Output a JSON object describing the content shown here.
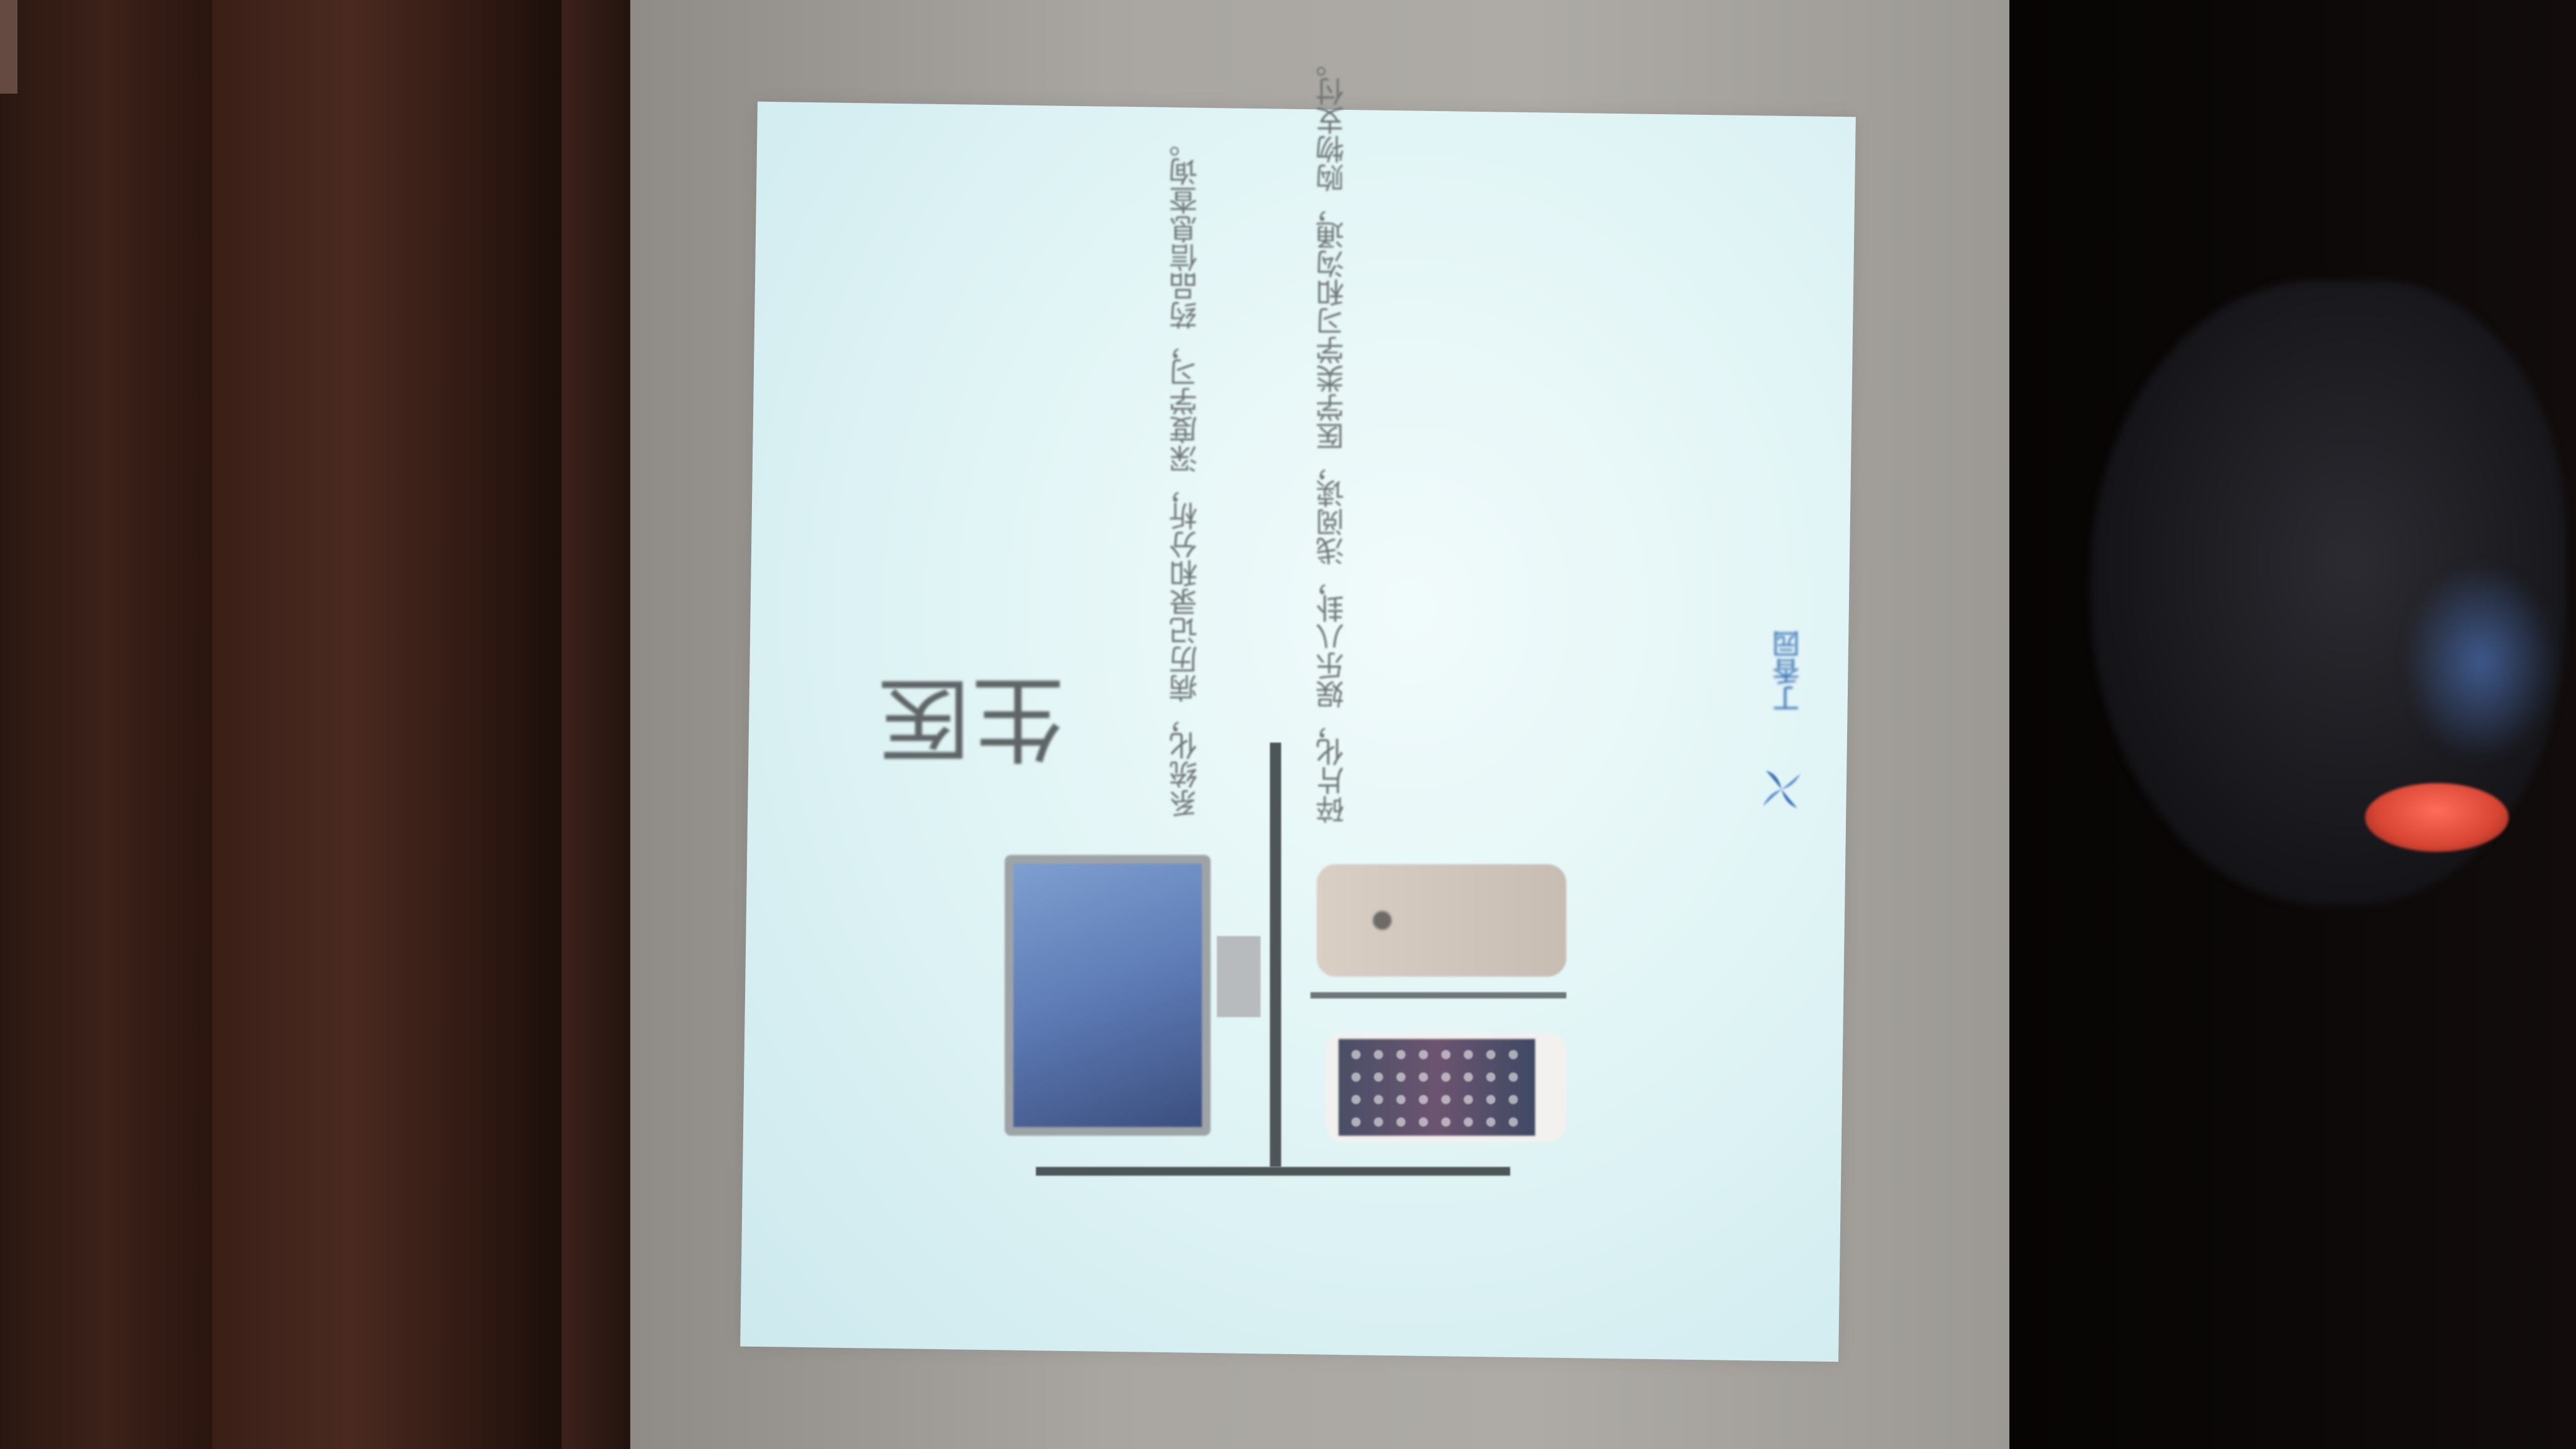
{
  "slide": {
    "title": "医生",
    "text_block_1": "系统化，病历记录和分析，深度学习，药品信息查询。",
    "text_block_2": "碎片化，娱乐八卦，浅阅读，医学类学习和沟通，购物支付。",
    "logo_text": "丁香园"
  },
  "colors": {
    "slide_background": "#e2f5f6",
    "projector_screen": "#a9a6a1",
    "title_text": "#5f6566",
    "body_text": "#6f7576",
    "logo_blue": "#3b73b5"
  }
}
